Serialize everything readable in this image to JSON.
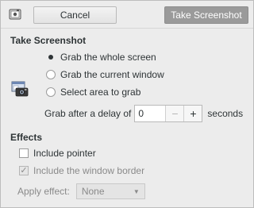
{
  "header": {
    "cancel_label": "Cancel",
    "take_label": "Take Screenshot"
  },
  "take": {
    "title": "Take Screenshot",
    "options": [
      {
        "label": "Grab the whole screen",
        "checked": true
      },
      {
        "label": "Grab the current window",
        "checked": false
      },
      {
        "label": "Select area to grab",
        "checked": false
      }
    ],
    "delay_label": "Grab after a delay of",
    "delay_value": "0",
    "minus": "−",
    "plus": "+",
    "seconds_label": "seconds"
  },
  "effects": {
    "title": "Effects",
    "include_pointer": {
      "label": "Include pointer",
      "checked": false
    },
    "include_border": {
      "label": "Include the window border",
      "checked": true,
      "disabled": true
    },
    "apply_label": "Apply effect:",
    "apply_value": "None"
  },
  "icons": {
    "app": "screenshot-app-icon",
    "illustration": "screenshot-illustration-icon",
    "caret": "chevron-down-icon"
  },
  "colors": {
    "primary_button_bg": "#9a9a9a",
    "background": "#ececec"
  }
}
